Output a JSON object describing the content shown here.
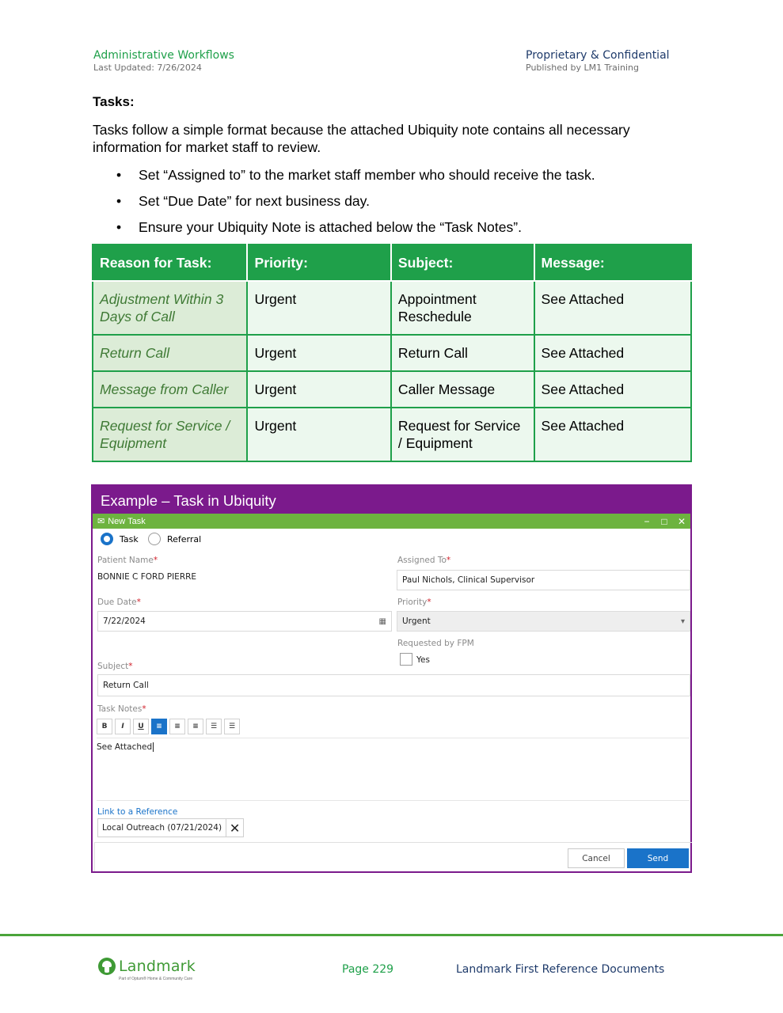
{
  "header": {
    "left_title": "Administrative Workflows",
    "left_sub": "Last Updated: 7/26/2024",
    "right_title": "Proprietary & Confidential",
    "right_sub": "Published by LM1 Training"
  },
  "section": {
    "title": "Tasks:",
    "intro": "Tasks follow a simple format because the attached Ubiquity note contains all necessary information for market staff to review.",
    "bullets": [
      "Set “Assigned to” to the market staff member who should receive the task.",
      "Set “Due Date” for next business day.",
      "Ensure your Ubiquity Note is attached below the “Task Notes”."
    ]
  },
  "table": {
    "headers": [
      "Reason for Task:",
      "Priority:",
      "Subject:",
      "Message:"
    ],
    "rows": [
      [
        "Adjustment Within 3 Days of Call",
        "Urgent",
        "Appointment Reschedule",
        "See Attached"
      ],
      [
        "Return Call",
        "Urgent",
        "Return Call",
        "See Attached"
      ],
      [
        "Message from Caller",
        "Urgent",
        "Caller Message",
        "See Attached"
      ],
      [
        "Request for Service / Equipment",
        "Urgent",
        "Request for Service / Equipment",
        "See Attached"
      ]
    ]
  },
  "example": {
    "title": "Example – Task in Ubiquity",
    "window_title": "New Task",
    "window_controls": [
      "−",
      "□",
      "✕"
    ],
    "radio_task": "Task",
    "radio_referral": "Referral",
    "patient_name_label": "Patient Name",
    "patient_name": "BONNIE C FORD PIERRE",
    "assigned_to_label": "Assigned To",
    "assigned_to": "Paul Nichols, Clinical Supervisor",
    "due_date_label": "Due Date",
    "due_date": "7/22/2024",
    "priority_label": "Priority",
    "priority": "Urgent",
    "requested_by_label": "Requested by FPM",
    "yes_label": "Yes",
    "subject_label": "Subject",
    "subject": "Return Call",
    "task_notes_label": "Task Notes",
    "toolbar": [
      "B",
      "I",
      "U",
      "≡",
      "≡",
      "≡",
      "☰",
      "☰"
    ],
    "notes_text": "See Attached",
    "link_label": "Link to a Reference",
    "reference": "Local Outreach (07/21/2024)",
    "reference_remove": "✕",
    "cancel": "Cancel",
    "send": "Send",
    "required_mark": "*",
    "calendar_glyph": "▦",
    "dropdown_glyph": "▾"
  },
  "footer": {
    "logo_word": "Landmark",
    "logo_sub": "Part of Optum® Home & Community Care",
    "page": "Page 229",
    "doc": "Landmark First Reference Documents"
  },
  "colors": {
    "brand_green": "#1fa04a",
    "purple": "#7b1a8c",
    "window_green": "#6db33f",
    "accent_blue": "#1a73c9"
  }
}
